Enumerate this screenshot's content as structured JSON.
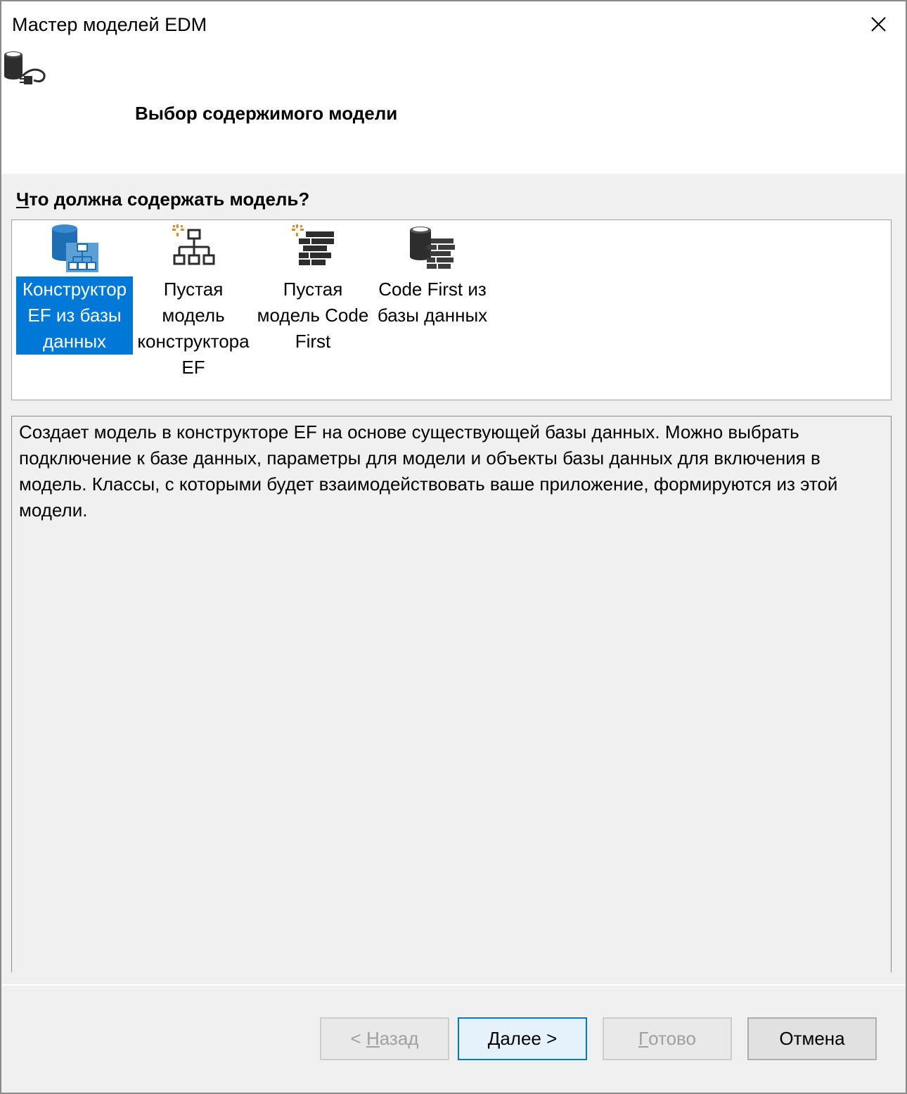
{
  "window": {
    "title": "Мастер моделей EDM",
    "close_icon": "close-icon"
  },
  "header": {
    "icon": "database-plug-icon",
    "step_title": "Выбор содержимого модели"
  },
  "question": {
    "underlined_char": "Ч",
    "rest": "то должна содержать модель?"
  },
  "options": [
    {
      "label": "Конструктор EF из базы данных",
      "icon": "database-hierarchy-icon",
      "selected": true
    },
    {
      "label": "Пустая модель конструктора EF",
      "icon": "empty-hierarchy-icon",
      "selected": false
    },
    {
      "label": "Пустая модель Code First",
      "icon": "empty-code-first-icon",
      "selected": false
    },
    {
      "label": "Code First из базы данных",
      "icon": "database-code-first-icon",
      "selected": false
    }
  ],
  "description": "Создает модель в конструкторе EF на основе существующей базы данных. Можно выбрать подключение к базе данных, параметры для модели и объекты базы данных для включения в модель. Классы, с которыми будет взаимодействовать ваше приложение, формируются из этой модели.",
  "buttons": {
    "back": {
      "prefix": "< ",
      "mnemonic": "Н",
      "rest": "азад",
      "enabled": false
    },
    "next": {
      "mnemonic": "Д",
      "rest": "алее >",
      "enabled": true
    },
    "finish": {
      "mnemonic": "Г",
      "rest": "отово",
      "enabled": false
    },
    "cancel": {
      "label": "Отмена",
      "enabled": true
    }
  },
  "colors": {
    "selection": "#0078d7",
    "icon_blue": "#1e6eb4",
    "icon_dark": "#2d2d2d",
    "spark_orange": "#e8862a"
  }
}
